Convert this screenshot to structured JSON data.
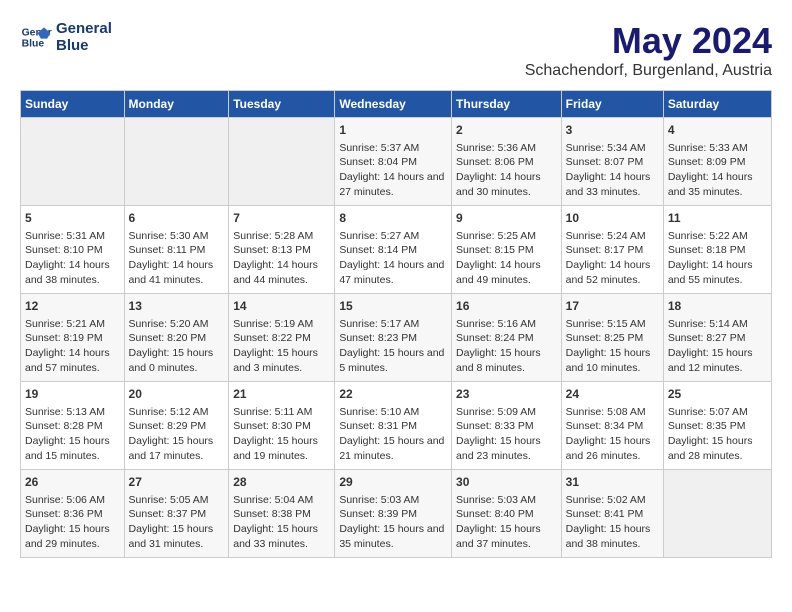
{
  "logo": {
    "line1": "General",
    "line2": "Blue"
  },
  "title": "May 2024",
  "location": "Schachendorf, Burgenland, Austria",
  "weekdays": [
    "Sunday",
    "Monday",
    "Tuesday",
    "Wednesday",
    "Thursday",
    "Friday",
    "Saturday"
  ],
  "weeks": [
    [
      {
        "day": "",
        "sunrise": "",
        "sunset": "",
        "daylight": ""
      },
      {
        "day": "",
        "sunrise": "",
        "sunset": "",
        "daylight": ""
      },
      {
        "day": "",
        "sunrise": "",
        "sunset": "",
        "daylight": ""
      },
      {
        "day": "1",
        "sunrise": "Sunrise: 5:37 AM",
        "sunset": "Sunset: 8:04 PM",
        "daylight": "Daylight: 14 hours and 27 minutes."
      },
      {
        "day": "2",
        "sunrise": "Sunrise: 5:36 AM",
        "sunset": "Sunset: 8:06 PM",
        "daylight": "Daylight: 14 hours and 30 minutes."
      },
      {
        "day": "3",
        "sunrise": "Sunrise: 5:34 AM",
        "sunset": "Sunset: 8:07 PM",
        "daylight": "Daylight: 14 hours and 33 minutes."
      },
      {
        "day": "4",
        "sunrise": "Sunrise: 5:33 AM",
        "sunset": "Sunset: 8:09 PM",
        "daylight": "Daylight: 14 hours and 35 minutes."
      }
    ],
    [
      {
        "day": "5",
        "sunrise": "Sunrise: 5:31 AM",
        "sunset": "Sunset: 8:10 PM",
        "daylight": "Daylight: 14 hours and 38 minutes."
      },
      {
        "day": "6",
        "sunrise": "Sunrise: 5:30 AM",
        "sunset": "Sunset: 8:11 PM",
        "daylight": "Daylight: 14 hours and 41 minutes."
      },
      {
        "day": "7",
        "sunrise": "Sunrise: 5:28 AM",
        "sunset": "Sunset: 8:13 PM",
        "daylight": "Daylight: 14 hours and 44 minutes."
      },
      {
        "day": "8",
        "sunrise": "Sunrise: 5:27 AM",
        "sunset": "Sunset: 8:14 PM",
        "daylight": "Daylight: 14 hours and 47 minutes."
      },
      {
        "day": "9",
        "sunrise": "Sunrise: 5:25 AM",
        "sunset": "Sunset: 8:15 PM",
        "daylight": "Daylight: 14 hours and 49 minutes."
      },
      {
        "day": "10",
        "sunrise": "Sunrise: 5:24 AM",
        "sunset": "Sunset: 8:17 PM",
        "daylight": "Daylight: 14 hours and 52 minutes."
      },
      {
        "day": "11",
        "sunrise": "Sunrise: 5:22 AM",
        "sunset": "Sunset: 8:18 PM",
        "daylight": "Daylight: 14 hours and 55 minutes."
      }
    ],
    [
      {
        "day": "12",
        "sunrise": "Sunrise: 5:21 AM",
        "sunset": "Sunset: 8:19 PM",
        "daylight": "Daylight: 14 hours and 57 minutes."
      },
      {
        "day": "13",
        "sunrise": "Sunrise: 5:20 AM",
        "sunset": "Sunset: 8:20 PM",
        "daylight": "Daylight: 15 hours and 0 minutes."
      },
      {
        "day": "14",
        "sunrise": "Sunrise: 5:19 AM",
        "sunset": "Sunset: 8:22 PM",
        "daylight": "Daylight: 15 hours and 3 minutes."
      },
      {
        "day": "15",
        "sunrise": "Sunrise: 5:17 AM",
        "sunset": "Sunset: 8:23 PM",
        "daylight": "Daylight: 15 hours and 5 minutes."
      },
      {
        "day": "16",
        "sunrise": "Sunrise: 5:16 AM",
        "sunset": "Sunset: 8:24 PM",
        "daylight": "Daylight: 15 hours and 8 minutes."
      },
      {
        "day": "17",
        "sunrise": "Sunrise: 5:15 AM",
        "sunset": "Sunset: 8:25 PM",
        "daylight": "Daylight: 15 hours and 10 minutes."
      },
      {
        "day": "18",
        "sunrise": "Sunrise: 5:14 AM",
        "sunset": "Sunset: 8:27 PM",
        "daylight": "Daylight: 15 hours and 12 minutes."
      }
    ],
    [
      {
        "day": "19",
        "sunrise": "Sunrise: 5:13 AM",
        "sunset": "Sunset: 8:28 PM",
        "daylight": "Daylight: 15 hours and 15 minutes."
      },
      {
        "day": "20",
        "sunrise": "Sunrise: 5:12 AM",
        "sunset": "Sunset: 8:29 PM",
        "daylight": "Daylight: 15 hours and 17 minutes."
      },
      {
        "day": "21",
        "sunrise": "Sunrise: 5:11 AM",
        "sunset": "Sunset: 8:30 PM",
        "daylight": "Daylight: 15 hours and 19 minutes."
      },
      {
        "day": "22",
        "sunrise": "Sunrise: 5:10 AM",
        "sunset": "Sunset: 8:31 PM",
        "daylight": "Daylight: 15 hours and 21 minutes."
      },
      {
        "day": "23",
        "sunrise": "Sunrise: 5:09 AM",
        "sunset": "Sunset: 8:33 PM",
        "daylight": "Daylight: 15 hours and 23 minutes."
      },
      {
        "day": "24",
        "sunrise": "Sunrise: 5:08 AM",
        "sunset": "Sunset: 8:34 PM",
        "daylight": "Daylight: 15 hours and 26 minutes."
      },
      {
        "day": "25",
        "sunrise": "Sunrise: 5:07 AM",
        "sunset": "Sunset: 8:35 PM",
        "daylight": "Daylight: 15 hours and 28 minutes."
      }
    ],
    [
      {
        "day": "26",
        "sunrise": "Sunrise: 5:06 AM",
        "sunset": "Sunset: 8:36 PM",
        "daylight": "Daylight: 15 hours and 29 minutes."
      },
      {
        "day": "27",
        "sunrise": "Sunrise: 5:05 AM",
        "sunset": "Sunset: 8:37 PM",
        "daylight": "Daylight: 15 hours and 31 minutes."
      },
      {
        "day": "28",
        "sunrise": "Sunrise: 5:04 AM",
        "sunset": "Sunset: 8:38 PM",
        "daylight": "Daylight: 15 hours and 33 minutes."
      },
      {
        "day": "29",
        "sunrise": "Sunrise: 5:03 AM",
        "sunset": "Sunset: 8:39 PM",
        "daylight": "Daylight: 15 hours and 35 minutes."
      },
      {
        "day": "30",
        "sunrise": "Sunrise: 5:03 AM",
        "sunset": "Sunset: 8:40 PM",
        "daylight": "Daylight: 15 hours and 37 minutes."
      },
      {
        "day": "31",
        "sunrise": "Sunrise: 5:02 AM",
        "sunset": "Sunset: 8:41 PM",
        "daylight": "Daylight: 15 hours and 38 minutes."
      },
      {
        "day": "",
        "sunrise": "",
        "sunset": "",
        "daylight": ""
      }
    ]
  ]
}
